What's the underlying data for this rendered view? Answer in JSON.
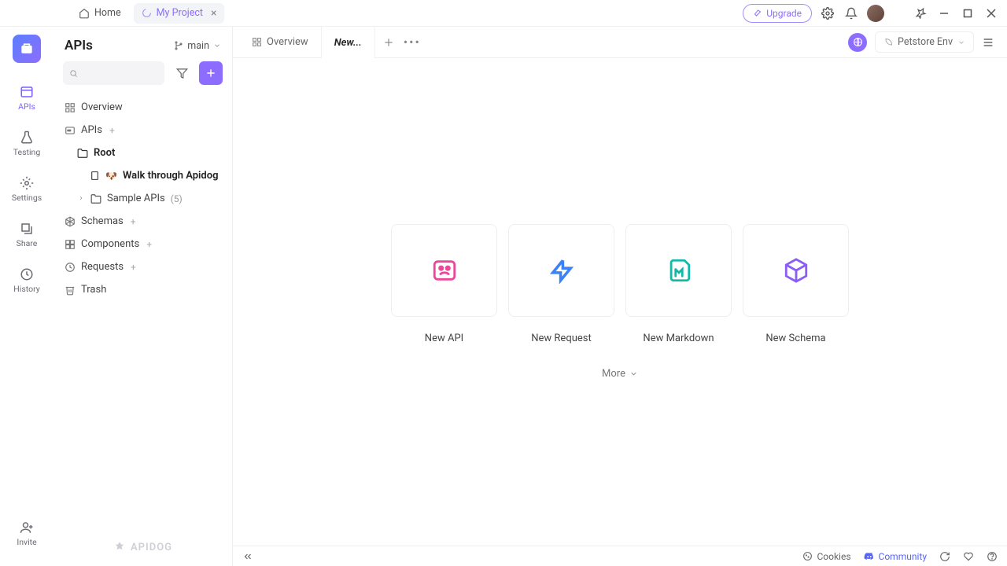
{
  "titlebar": {
    "home": "Home",
    "project": "My Project",
    "upgrade": "Upgrade"
  },
  "rail": {
    "items": [
      {
        "label": "APIs"
      },
      {
        "label": "Testing"
      },
      {
        "label": "Settings"
      },
      {
        "label": "Share"
      },
      {
        "label": "History"
      }
    ],
    "invite": "Invite"
  },
  "sidebar": {
    "title": "APIs",
    "branch": "main",
    "search_placeholder": "",
    "tree": {
      "overview": "Overview",
      "apis": "APIs",
      "root": "Root",
      "walk": "Walk through Apidog",
      "sample": "Sample APIs",
      "sample_count": "(5)",
      "schemas": "Schemas",
      "components": "Components",
      "requests": "Requests",
      "trash": "Trash"
    },
    "brand": "APIDOG"
  },
  "main": {
    "tabs": {
      "overview": "Overview",
      "new": "New..."
    },
    "env": {
      "label": "Petstore Env"
    },
    "cards": [
      {
        "label": "New API"
      },
      {
        "label": "New Request"
      },
      {
        "label": "New Markdown"
      },
      {
        "label": "New Schema"
      }
    ],
    "more": "More"
  },
  "statusbar": {
    "cookies": "Cookies",
    "community": "Community"
  }
}
